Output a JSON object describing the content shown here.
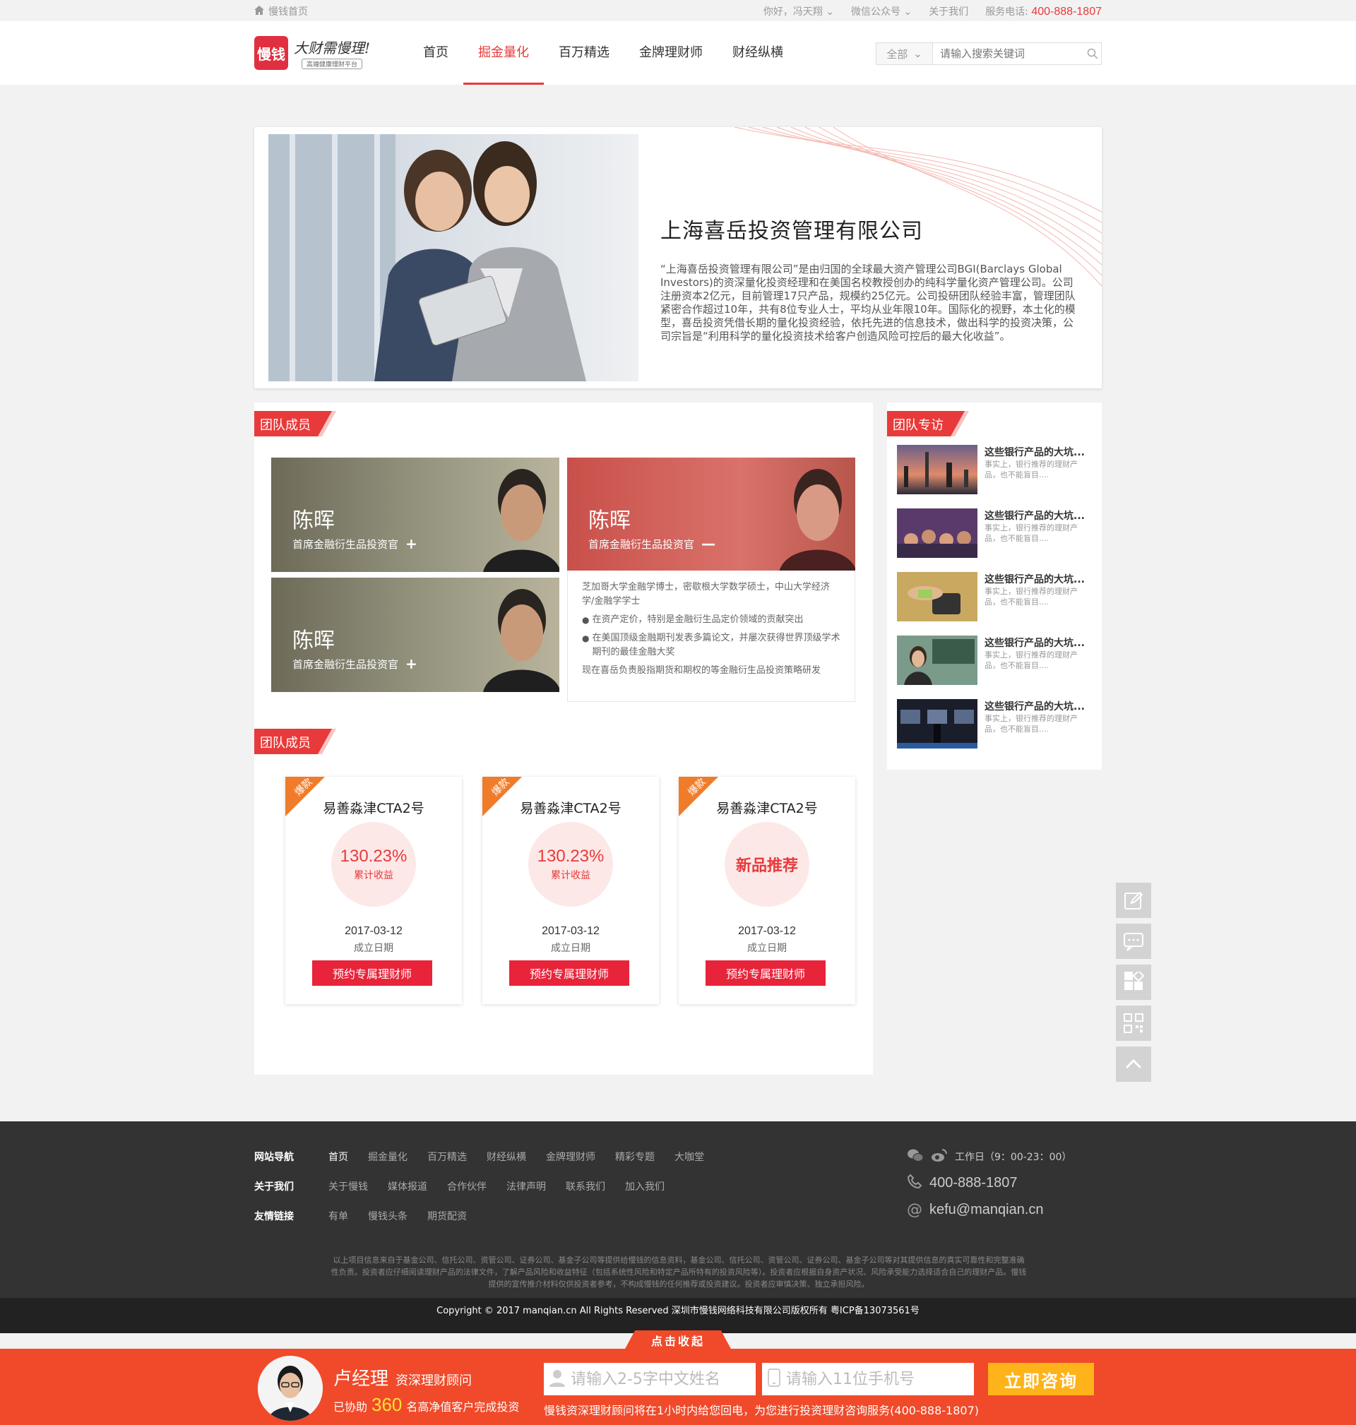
{
  "topbar": {
    "home_label": "慢钱首页",
    "greeting": "你好，冯天翔",
    "wechat": "微信公众号",
    "about": "关于我们",
    "service_label": "服务电话:",
    "phone": "400-888-1807"
  },
  "header": {
    "logo_mark": "慢钱",
    "logo_slogan": "大财需慢理!",
    "logo_sub": "高端健康理财平台",
    "nav": [
      "首页",
      "掘金量化",
      "百万精选",
      "金牌理财师",
      "财经纵横"
    ],
    "active_nav": 1,
    "search_category": "全部",
    "search_placeholder": "请输入搜索关键词"
  },
  "company": {
    "name": "上海喜岳投资管理有限公司",
    "description": "“上海喜岳投资管理有限公司”是由归国的全球最大资产管理公司BGI(Barclays Global Investors)的资深量化投资经理和在美国名校教授创办的纯科学量化资产管理公司。公司注册资本2亿元，目前管理17只产品，规模约25亿元。公司投研团队经验丰富，管理团队紧密合作超过10年，共有8位专业人士，平均从业年限10年。国际化的视野，本土化的模型，喜岳投资凭借长期的量化投资经验，依托先进的信息技术，做出科学的投资决策，公司宗旨是“利用科学的量化投资技术给客户创造风险可控后的最大化收益”。"
  },
  "team": {
    "section_title": "团队成员",
    "members": [
      {
        "name": "陈晖",
        "title": "首席金融衍生品投资官",
        "toggle": "+"
      },
      {
        "name": "陈晖",
        "title": "首席金融衍生品投资官",
        "toggle": "—"
      },
      {
        "name": "陈晖",
        "title": "首席金融衍生品投资官",
        "toggle": "+"
      }
    ],
    "detail": {
      "intro": "芝加哥大学金融学博士，密歇根大学数学硕士，中山大学经济学/金融学学士",
      "points": [
        "在资产定价，特别是金融衍生品定价领域的贡献突出",
        "在美国顶级金融期刊发表多篇论文，并屡次获得世界顶级学术期刊的最佳金融大奖"
      ],
      "current": "现在喜岳负责股指期货和期权的等金融衍生品投资策略研发"
    }
  },
  "products": {
    "section_title": "团队成员",
    "items": [
      {
        "badge": "爆款",
        "name": "易善淼津CTA2号",
        "rate": "130.23%",
        "rate_label": "累计收益",
        "date": "2017-03-12",
        "date_label": "成立日期",
        "button": "预约专属理财师"
      },
      {
        "badge": "爆款",
        "name": "易善淼津CTA2号",
        "rate": "130.23%",
        "rate_label": "累计收益",
        "date": "2017-03-12",
        "date_label": "成立日期",
        "button": "预约专属理财师"
      },
      {
        "badge": "爆款",
        "name": "易善淼津CTA2号",
        "new_label": "新品推荐",
        "date": "2017-03-12",
        "date_label": "成立日期",
        "button": "预约专属理财师"
      }
    ]
  },
  "interviews": {
    "section_title": "团队专访",
    "items": [
      {
        "title": "这些银行产品的大坑...",
        "summary": "事实上，银行推荐的理财产品，也不能盲目...."
      },
      {
        "title": "这些银行产品的大坑...",
        "summary": "事实上，银行推荐的理财产品，也不能盲目...."
      },
      {
        "title": "这些银行产品的大坑...",
        "summary": "事实上，银行推荐的理财产品，也不能盲目...."
      },
      {
        "title": "这些银行产品的大坑...",
        "summary": "事实上，银行推荐的理财产品，也不能盲目...."
      },
      {
        "title": "这些银行产品的大坑...",
        "summary": "事实上，银行推荐的理财产品，也不能盲目...."
      }
    ]
  },
  "footer": {
    "rows": [
      {
        "heading": "网站导航",
        "links": [
          "首页",
          "掘金量化",
          "百万精选",
          "财经纵横",
          "金牌理财师",
          "精彩专题",
          "大咖堂"
        ]
      },
      {
        "heading": "关于我们",
        "links": [
          "关于慢钱",
          "媒体报道",
          "合作伙伴",
          "法律声明",
          "联系我们",
          "加入我们"
        ]
      },
      {
        "heading": "友情链接",
        "links": [
          "有单",
          "慢钱头条",
          "期货配资"
        ]
      }
    ],
    "hours": "工作日（9：00-23：00）",
    "phone": "400-888-1807",
    "email": "kefu@manqian.cn",
    "disclaimer": "以上项目信息来自于基金公司、信托公司、资管公司、证券公司、基金子公司等提供给慢钱的信息资料，基金公司、信托公司、资管公司、证券公司、基金子公司等对其提供信息的真实可靠性和完整准确性负责。投资者应仔细阅读理财产品的法律文件，了解产品风险和收益特征（包括系统性风险和特定产品所特有的投资风险等）。投资者应根据自身资产状况、风险承受能力选择适合自己的理财产品。慢钱提供的宣传推介材料仅供投资者参考，不构成慢钱的任何推荐或投资建议。投资者应审慎决策、独立承担风险。",
    "copyright": "Copyright © 2017 manqian.cn All Rights Reserved 深圳市慢钱网络科技有限公司版权所有 粤ICP备13073561号"
  },
  "consult": {
    "collapse_label": "点击收起",
    "manager_name": "卢经理",
    "manager_role": "资深理财顾问",
    "helped_prefix": "已协助",
    "helped_count": "360",
    "helped_suffix": "名高净值客户完成投资",
    "name_placeholder": "请输入2-5字中文姓名",
    "phone_placeholder": "请输入11位手机号",
    "button": "立即咨询",
    "note": "慢钱资深理财顾问将在1小时内给您回电，为您进行投资理财咨询服务(400-888-1807)"
  },
  "colors": {
    "accent": "#e83a3a",
    "consult_bar": "#f04a2a",
    "consult_button": "#ffb31a",
    "footer_bg": "#333333"
  }
}
